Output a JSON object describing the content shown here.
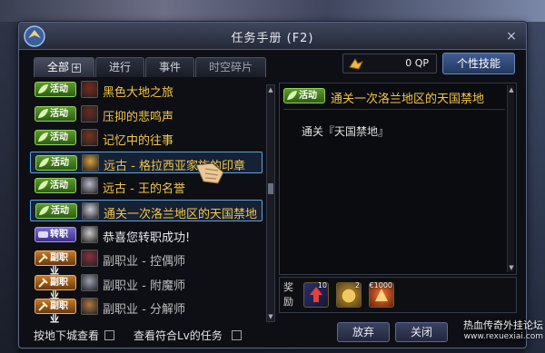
{
  "window": {
    "title": "任务手册 (F2)",
    "close_label": "×"
  },
  "tabs": [
    {
      "label": "全部",
      "active": true,
      "plus": "+"
    },
    {
      "label": "进行",
      "active": false
    },
    {
      "label": "事件",
      "active": false
    },
    {
      "label": "时空碎片",
      "active": false
    }
  ],
  "qp": {
    "value": "0 QP",
    "icon": "qp-coin-icon"
  },
  "skill_button": {
    "label": "个性技能"
  },
  "quests": [
    {
      "badge": "活动",
      "type": "act",
      "name": "黑色大地之旅",
      "color": "gold",
      "selected": false
    },
    {
      "badge": "活动",
      "type": "act",
      "name": "压抑的悲鸣声",
      "color": "gold",
      "selected": false
    },
    {
      "badge": "活动",
      "type": "act",
      "name": "记忆中的往事",
      "color": "gold",
      "selected": false
    },
    {
      "badge": "活动",
      "type": "act",
      "name": "远古 - 格拉西亚家族的印章",
      "color": "gold",
      "selected": true
    },
    {
      "badge": "活动",
      "type": "act",
      "name": "远古 - 王的名誉",
      "color": "gold",
      "selected": false
    },
    {
      "badge": "活动",
      "type": "act",
      "name": "通关一次洛兰地区的天国禁地",
      "color": "gold",
      "selected": true
    },
    {
      "badge": "转职",
      "type": "job",
      "name": "恭喜您转职成功!",
      "color": "white",
      "selected": false
    },
    {
      "badge": "副职业",
      "type": "sub",
      "name": "副职业 - 控偶师",
      "color": "gray",
      "selected": false
    },
    {
      "badge": "副职业",
      "type": "sub",
      "name": "副职业 - 附魔师",
      "color": "gray",
      "selected": false
    },
    {
      "badge": "副职业",
      "type": "sub",
      "name": "副职业 - 分解师",
      "color": "gray",
      "selected": false
    }
  ],
  "filters": {
    "by_region": "按地下城查看",
    "by_level": "查看符合Lv的任务"
  },
  "detail": {
    "badge": "活动",
    "title": "通关一次洛兰地区的天国禁地",
    "body": "通关『天国禁地』"
  },
  "reward": {
    "label": "奖励",
    "items": [
      {
        "icon": "level-up-icon",
        "count": "10"
      },
      {
        "icon": "coin-bag-icon",
        "count": "2"
      },
      {
        "icon": "exp-orb-icon",
        "count": "€1000"
      }
    ]
  },
  "buttons": {
    "abandon": "放弃",
    "close": "关闭"
  },
  "watermark": {
    "site": "热血传奇外挂论坛",
    "url": "www.rexuexiai.com"
  }
}
